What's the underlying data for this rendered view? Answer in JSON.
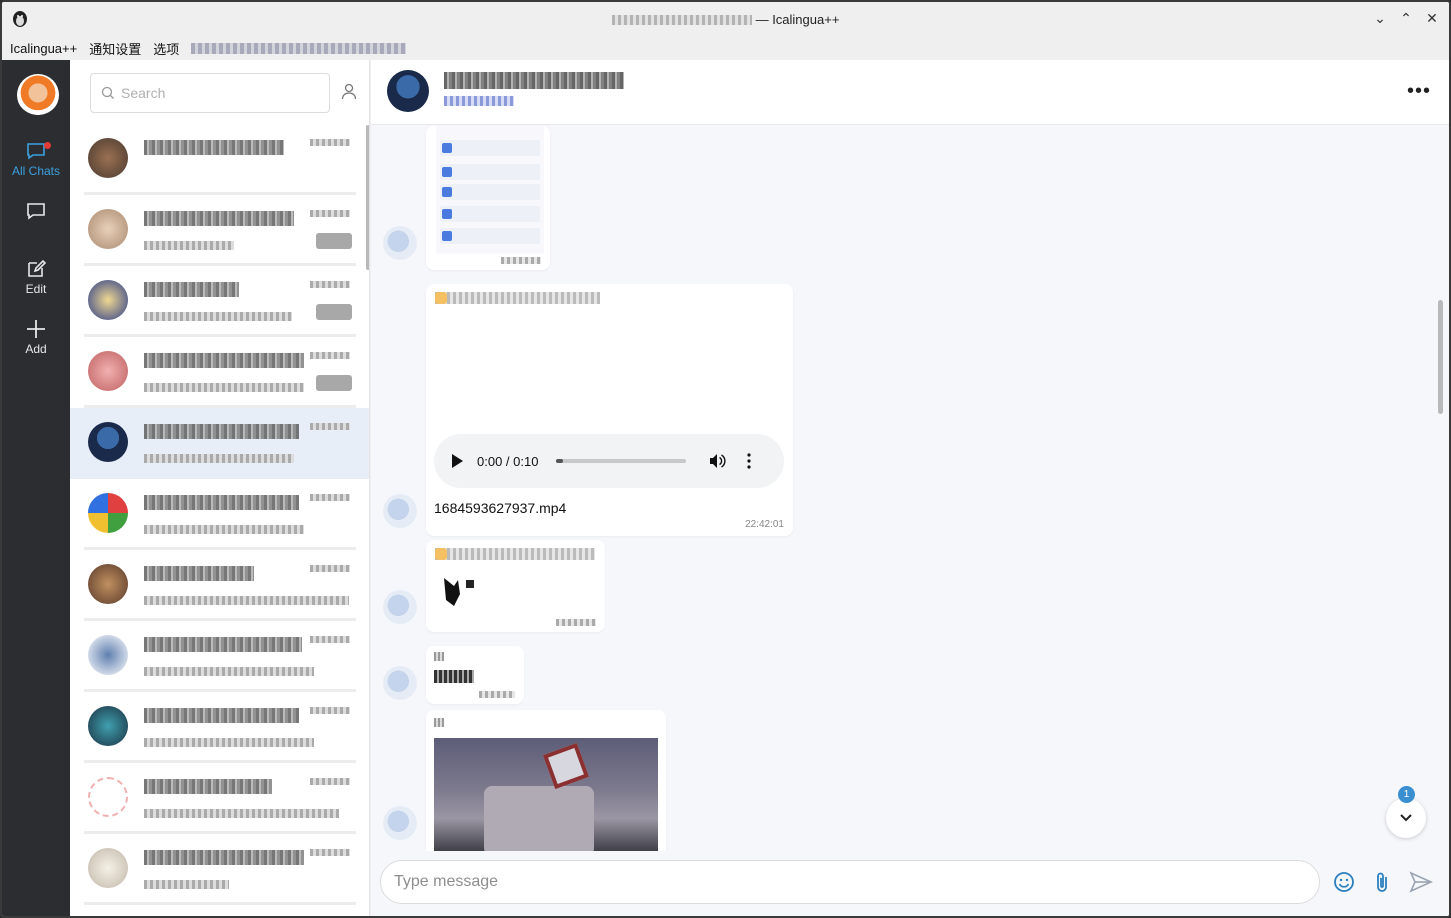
{
  "window": {
    "title_suffix": "— Icalingua++"
  },
  "menu": {
    "items": [
      "Icalingua++",
      "通知设置",
      "选项"
    ]
  },
  "rail": {
    "items": [
      {
        "label": "All Chats",
        "icon": "chat-bubble-icon"
      },
      {
        "label": "",
        "icon": "chat-bubble-outline-icon"
      },
      {
        "label": "Edit",
        "icon": "edit-icon"
      },
      {
        "label": "Add",
        "icon": "plus-icon"
      }
    ]
  },
  "search": {
    "placeholder": "Search"
  },
  "conversation": {
    "audio": {
      "current": "0:00",
      "duration": "0:10",
      "progress": 0.05
    },
    "video_filename": "1684593627937.mp4",
    "video_time": "22:42:01"
  },
  "scroll_button": {
    "unread_count": "1"
  },
  "composer": {
    "placeholder": "Type message"
  },
  "colors": {
    "accent": "#3ba1e0",
    "rail_bg": "#2b2d31",
    "badge": "#3a8fd0"
  }
}
